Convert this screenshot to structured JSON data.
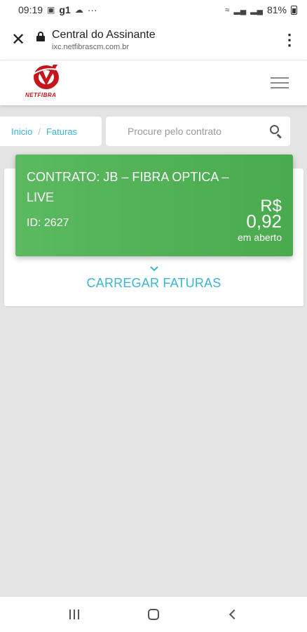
{
  "status_bar": {
    "time": "09:19",
    "carrier": "g1",
    "more": "···",
    "battery": "81%"
  },
  "browser": {
    "title": "Central do Assinante",
    "url": "ixc.netfibrascm.com.br"
  },
  "header": {
    "logo_text": "NETFIBRA"
  },
  "breadcrumb": {
    "items": [
      "Inicio",
      "Faturas"
    ],
    "separator": "/"
  },
  "search": {
    "placeholder": "Procure pelo contrato"
  },
  "contract": {
    "name": "CONTRATO: JB – FIBRA OPTICA – LIVE",
    "id_label": "ID: 2627",
    "currency": "R$",
    "amount": "0,92",
    "status": "em aberto",
    "card_color": "#4caf50"
  },
  "actions": {
    "load_more": "CARREGAR FATURAS",
    "accent": "#3bb5d1"
  }
}
